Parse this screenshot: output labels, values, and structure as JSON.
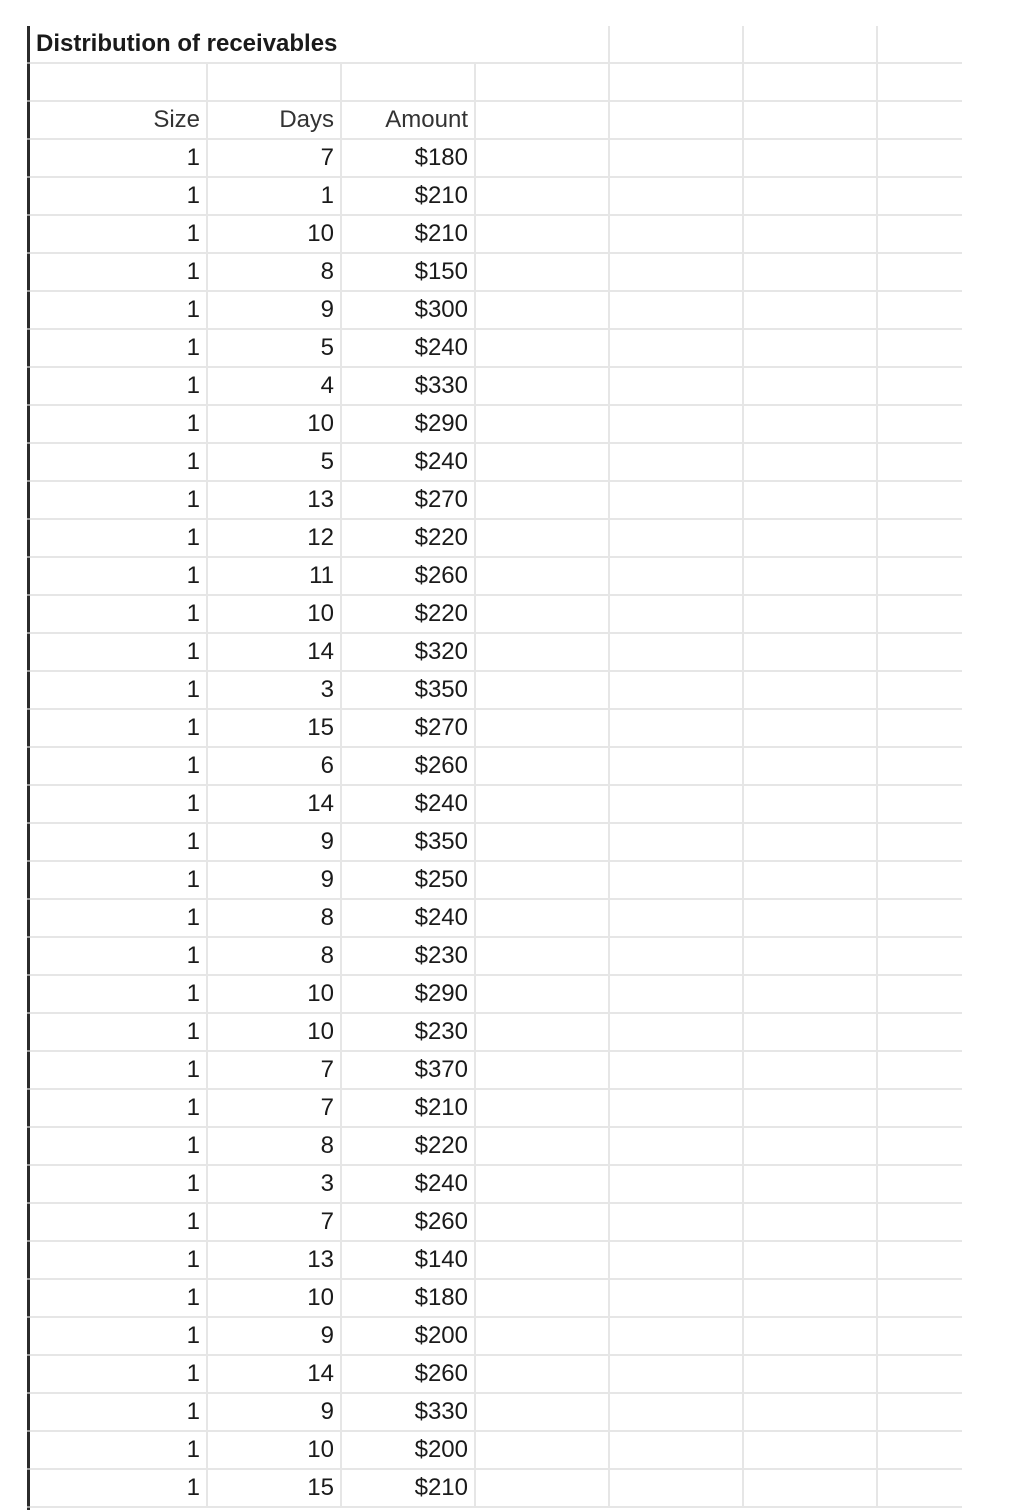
{
  "sheet": {
    "title": "Distribution of receivables",
    "headers": {
      "size": "Size",
      "days": "Days",
      "amount": "Amount"
    },
    "rows": [
      {
        "size": "1",
        "days": "7",
        "amount": "$180"
      },
      {
        "size": "1",
        "days": "1",
        "amount": "$210"
      },
      {
        "size": "1",
        "days": "10",
        "amount": "$210"
      },
      {
        "size": "1",
        "days": "8",
        "amount": "$150"
      },
      {
        "size": "1",
        "days": "9",
        "amount": "$300"
      },
      {
        "size": "1",
        "days": "5",
        "amount": "$240"
      },
      {
        "size": "1",
        "days": "4",
        "amount": "$330"
      },
      {
        "size": "1",
        "days": "10",
        "amount": "$290"
      },
      {
        "size": "1",
        "days": "5",
        "amount": "$240"
      },
      {
        "size": "1",
        "days": "13",
        "amount": "$270"
      },
      {
        "size": "1",
        "days": "12",
        "amount": "$220"
      },
      {
        "size": "1",
        "days": "11",
        "amount": "$260"
      },
      {
        "size": "1",
        "days": "10",
        "amount": "$220"
      },
      {
        "size": "1",
        "days": "14",
        "amount": "$320"
      },
      {
        "size": "1",
        "days": "3",
        "amount": "$350"
      },
      {
        "size": "1",
        "days": "15",
        "amount": "$270"
      },
      {
        "size": "1",
        "days": "6",
        "amount": "$260"
      },
      {
        "size": "1",
        "days": "14",
        "amount": "$240"
      },
      {
        "size": "1",
        "days": "9",
        "amount": "$350"
      },
      {
        "size": "1",
        "days": "9",
        "amount": "$250"
      },
      {
        "size": "1",
        "days": "8",
        "amount": "$240"
      },
      {
        "size": "1",
        "days": "8",
        "amount": "$230"
      },
      {
        "size": "1",
        "days": "10",
        "amount": "$290"
      },
      {
        "size": "1",
        "days": "10",
        "amount": "$230"
      },
      {
        "size": "1",
        "days": "7",
        "amount": "$370"
      },
      {
        "size": "1",
        "days": "7",
        "amount": "$210"
      },
      {
        "size": "1",
        "days": "8",
        "amount": "$220"
      },
      {
        "size": "1",
        "days": "3",
        "amount": "$240"
      },
      {
        "size": "1",
        "days": "7",
        "amount": "$260"
      },
      {
        "size": "1",
        "days": "13",
        "amount": "$140"
      },
      {
        "size": "1",
        "days": "10",
        "amount": "$180"
      },
      {
        "size": "1",
        "days": "9",
        "amount": "$200"
      },
      {
        "size": "1",
        "days": "14",
        "amount": "$260"
      },
      {
        "size": "1",
        "days": "9",
        "amount": "$330"
      },
      {
        "size": "1",
        "days": "10",
        "amount": "$200"
      },
      {
        "size": "1",
        "days": "15",
        "amount": "$210"
      }
    ]
  }
}
